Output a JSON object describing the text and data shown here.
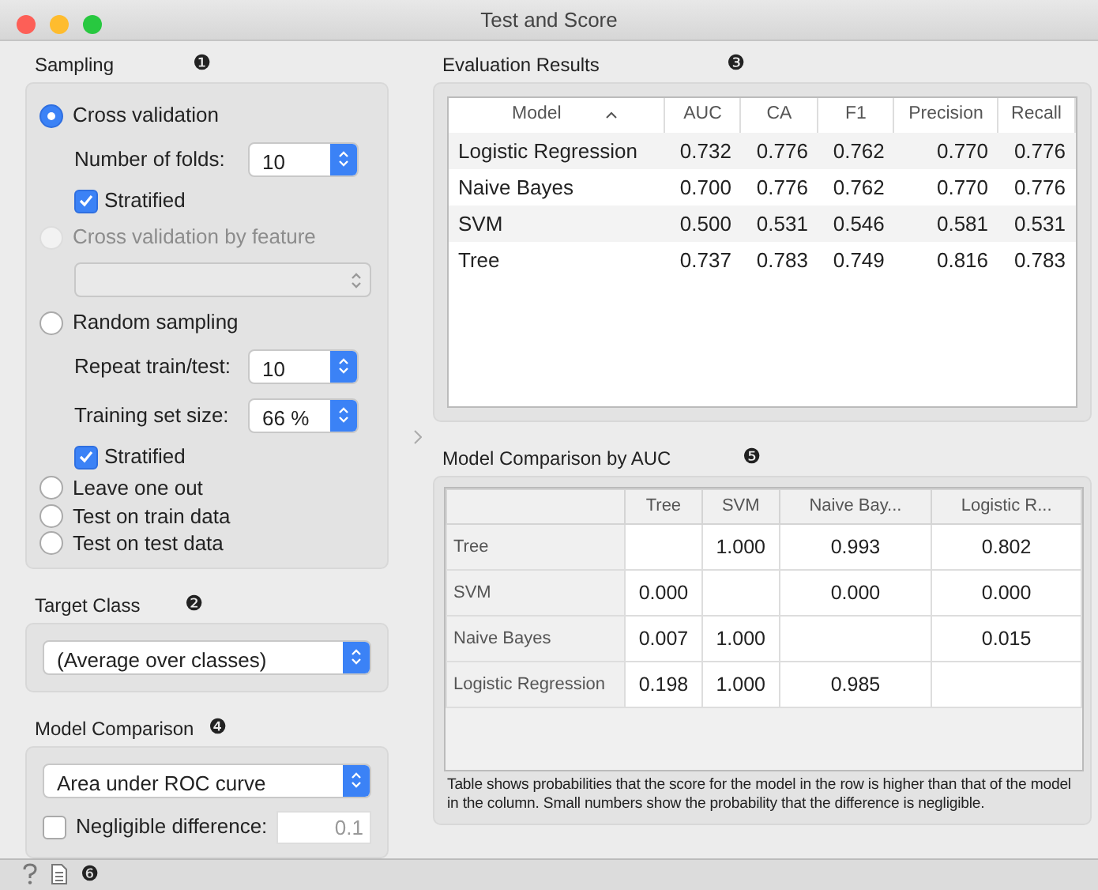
{
  "window": {
    "title": "Test and Score"
  },
  "sampling": {
    "title": "Sampling",
    "marker": "❶",
    "items": [
      {
        "kind": "radio",
        "label": "Cross validation",
        "selected": true,
        "disabled": false
      },
      {
        "kind": "spin",
        "label": "Number of folds:",
        "value": "10"
      },
      {
        "kind": "check",
        "label": "Stratified",
        "checked": true
      },
      {
        "kind": "radio",
        "label": "Cross validation by feature",
        "selected": false,
        "disabled": true
      },
      {
        "kind": "combo",
        "disabled": true
      },
      {
        "kind": "radio",
        "label": "Random sampling",
        "selected": false,
        "disabled": false
      },
      {
        "kind": "spin",
        "label": "Repeat train/test:",
        "value": "10"
      },
      {
        "kind": "spin",
        "label": "Training set size:",
        "value": "66 %"
      },
      {
        "kind": "check",
        "label": "Stratified",
        "checked": true
      },
      {
        "kind": "radio",
        "label": "Leave one out",
        "selected": false,
        "disabled": false
      },
      {
        "kind": "radio",
        "label": "Test on train data",
        "selected": false,
        "disabled": false
      },
      {
        "kind": "radio",
        "label": "Test on test data",
        "selected": false,
        "disabled": false
      }
    ]
  },
  "target_class": {
    "title": "Target Class",
    "marker": "❷",
    "value": "(Average over classes)"
  },
  "model_comparison": {
    "title": "Model Comparison",
    "marker": "❹",
    "value": "Area under ROC curve",
    "negligible": {
      "label": "Negligible difference:",
      "checked": false,
      "placeholder": "0.1"
    }
  },
  "evaluation": {
    "title": "Evaluation Results",
    "marker": "❸",
    "columns": [
      {
        "label": "Model",
        "sorted": true
      },
      {
        "label": "AUC",
        "sorted": false
      },
      {
        "label": "CA",
        "sorted": false
      },
      {
        "label": "F1",
        "sorted": false
      },
      {
        "label": "Precision",
        "sorted": false
      },
      {
        "label": "Recall",
        "sorted": false
      }
    ],
    "rows": [
      [
        "Logistic Regression",
        "0.732",
        "0.776",
        "0.762",
        "0.770",
        "0.776"
      ],
      [
        "Naive Bayes",
        "0.700",
        "0.776",
        "0.762",
        "0.770",
        "0.776"
      ],
      [
        "SVM",
        "0.500",
        "0.531",
        "0.546",
        "0.581",
        "0.531"
      ],
      [
        "Tree",
        "0.737",
        "0.783",
        "0.749",
        "0.816",
        "0.783"
      ]
    ]
  },
  "comparison": {
    "title": "Model Comparison by AUC",
    "marker": "❺",
    "columns": [
      "Tree",
      "SVM",
      "Naive Bay...",
      "Logistic R..."
    ],
    "rows": [
      {
        "label": "Tree",
        "cells": [
          "",
          "1.000",
          "0.993",
          "0.802"
        ]
      },
      {
        "label": "SVM",
        "cells": [
          "0.000",
          "",
          "0.000",
          "0.000"
        ]
      },
      {
        "label": "Naive Bayes",
        "cells": [
          "0.007",
          "1.000",
          "",
          "0.015"
        ]
      },
      {
        "label": "Logistic Regression",
        "cells": [
          "0.198",
          "1.000",
          "0.985",
          ""
        ]
      }
    ],
    "note": "Table shows probabilities that the score for the model in the row is higher than that of the model in the column. Small numbers show the probability that the difference is negligible."
  },
  "status_bar": {
    "marker": "❻"
  }
}
